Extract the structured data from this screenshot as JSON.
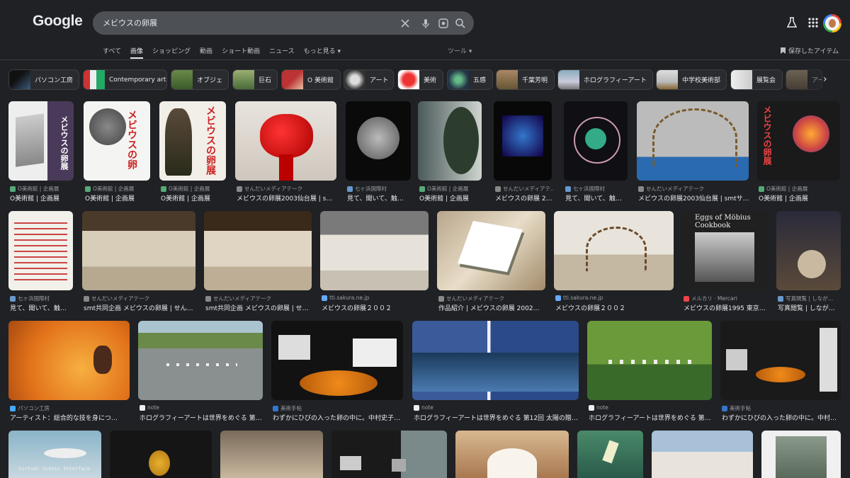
{
  "header": {
    "logo": "Google",
    "search_value": "メビウスの卵展"
  },
  "tabs": [
    "すべて",
    "画像",
    "ショッピング",
    "動画",
    "ショート動画",
    "ニュース",
    "もっと見る ▾"
  ],
  "active_tab": "画像",
  "tools_label": "ツール ▾",
  "saved_label": "保存したアイテム",
  "chips": [
    {
      "label": "パソコン工房"
    },
    {
      "label": "Contemporary art"
    },
    {
      "label": "オブジェ"
    },
    {
      "label": "巨石"
    },
    {
      "label": "O 美術館"
    },
    {
      "label": "アート"
    },
    {
      "label": "美術"
    },
    {
      "label": "五感"
    },
    {
      "label": "千葉芳明"
    },
    {
      "label": "ホログラフィーアート"
    },
    {
      "label": "中学校美術部"
    },
    {
      "label": "展覧会"
    },
    {
      "label": "アー"
    }
  ],
  "results": [
    {
      "source": "O美術館 | 企画展",
      "title": "O美術館 | 企画展"
    },
    {
      "source": "O美術館 | 企画展",
      "title": "O美術館 | 企画展"
    },
    {
      "source": "O美術館 | 企画展",
      "title": "O美術館 | 企画展"
    },
    {
      "source": "せんだいメディアテーク",
      "title": "メビウスの卵展2003仙台展 | sm…"
    },
    {
      "source": "七ヶ浜国際村",
      "title": "見て、聞いて、触…"
    },
    {
      "source": "O美術館 | 企画展",
      "title": "O美術館 | 企画展"
    },
    {
      "source": "せんだいメディアテ…",
      "title": "メビウスの卵展 20…"
    },
    {
      "source": "七ヶ浜国際村",
      "title": "見て、聞いて、触…"
    },
    {
      "source": "せんだいメディアテーク",
      "title": "メビウスの卵展2003仙台展 | smtサ…"
    },
    {
      "source": "O美術館 | 企画展",
      "title": "O美術館 | 企画展"
    },
    {
      "source": "七ヶ浜国際村",
      "title": "見て、聞いて、触…"
    },
    {
      "source": "せんだいメディアテーク",
      "title": "smt共同企画 メビウスの卵展 | せん…"
    },
    {
      "source": "せんだいメディアテーク",
      "title": "smt共同企画 メビウスの卵展 | せ…"
    },
    {
      "source": "tti.sakura.ne.jp",
      "title": "メビウスの卵展２００２"
    },
    {
      "source": "せんだいメディアテーク",
      "title": "作品紹介 | メビウスの卵展 2002仙…"
    },
    {
      "source": "tti.sakura.ne.jp",
      "title": "メビウスの卵展２００２"
    },
    {
      "source": "メルカリ · Mercari",
      "title": "メビウスの卵展1995 東京…"
    },
    {
      "source": "写真閲覧 | しなが…",
      "title": "写真閲覧 | しなが…"
    },
    {
      "source": "パソコン工房",
      "title": "アーティスト：総合的な技を身につけ…"
    },
    {
      "source": "note",
      "title": "ホログラフィーアートは世界をめぐる 第…"
    },
    {
      "source": "美術手帖",
      "title": "わずかにひびの入った卵の中に。中村史子…"
    },
    {
      "source": "note",
      "title": "ホログラフィーアートは世界をめぐる 第12回 太陽の贈…"
    },
    {
      "source": "note",
      "title": "ホログラフィーアートは世界をめぐる 第…"
    },
    {
      "source": "美術手帖",
      "title": "わずかにひびの入った卵の中に。中村…"
    }
  ],
  "bottom_thumb_text": "Virtual Scenic Interface",
  "poster_texts": {
    "r1c3": "メビウスの卵展",
    "r1c10": "メビウスの卵展",
    "r2c8": "Eggs of Möbius Cookbook"
  },
  "colors": {
    "background": "#202124",
    "search_bg": "#4d5156",
    "text_primary": "#e8eaed",
    "text_secondary": "#9aa0a6"
  }
}
